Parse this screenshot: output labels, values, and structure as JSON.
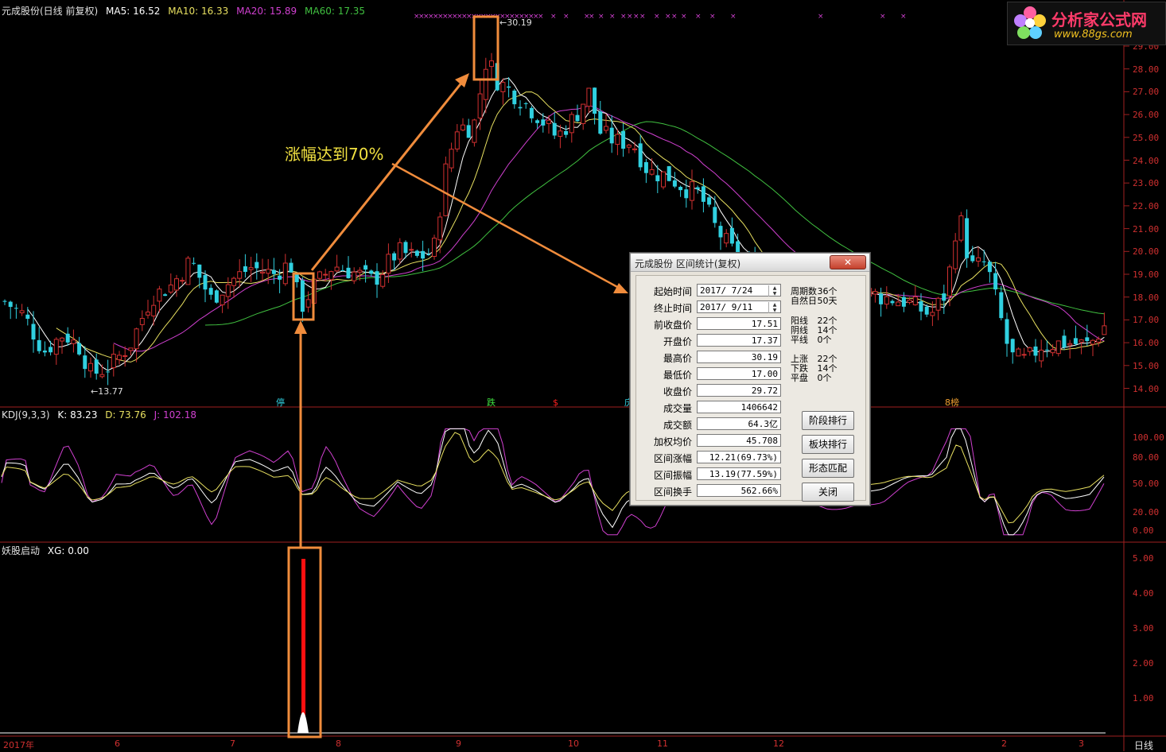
{
  "header": {
    "main": {
      "title": "元成股份(日线 前复权)",
      "ma5": "MA5: 16.52",
      "ma10": "MA10: 16.33",
      "ma20": "MA20: 15.89",
      "ma60": "MA60: 17.35"
    },
    "kdj": {
      "title": "KDJ(9,3,3)",
      "k": "K: 83.23",
      "d": "D: 73.76",
      "j": "J: 102.18"
    },
    "xg": {
      "title": "妖股启动",
      "xg": "XG: 0.00"
    }
  },
  "colors": {
    "ma5": "#ffffff",
    "ma10": "#e8e060",
    "ma20": "#d040d0",
    "ma60": "#40c040",
    "up": "#d03030",
    "down": "#30d0e0",
    "annotation": "#f08c3c",
    "k": "#ffffff",
    "d": "#e8e060",
    "j": "#d040d0",
    "xg_bar": "#ff1010"
  },
  "price_axis": [
    "29.00",
    "28.00",
    "27.00",
    "26.00",
    "25.00",
    "24.00",
    "23.00",
    "22.00",
    "21.00",
    "20.00",
    "19.00",
    "18.00",
    "17.00",
    "16.00",
    "15.00",
    "14.00"
  ],
  "kdj_axis": [
    "100.00",
    "80.00",
    "50.00",
    "20.00",
    "0.00"
  ],
  "xg_axis": [
    "5.00",
    "4.00",
    "3.00",
    "2.00",
    "1.00"
  ],
  "date_axis": [
    "2017年",
    "6",
    "7",
    "8",
    "9",
    "10",
    "11",
    "12",
    "2",
    "3"
  ],
  "period_label": "日线",
  "markers": {
    "high": "30.19",
    "low": "13.77"
  },
  "event_labels": [
    {
      "text": "停",
      "color": "#30d0e0"
    },
    {
      "text": "跌",
      "color": "#40e040"
    },
    {
      "text": "$",
      "color": "#ff2020"
    },
    {
      "text": "庆",
      "color": "#30d0e0"
    },
    {
      "text": "8榜",
      "color": "#f0a030"
    }
  ],
  "annotation": {
    "text": "涨幅达到70%"
  },
  "logo": {
    "name": "分析家公式网",
    "url": "www.88gs.com"
  },
  "dialog": {
    "title": "元成股份 区间统计(复权)",
    "close": "✕",
    "fields": [
      {
        "label": "起始时间",
        "value": "2017/ 7/24"
      },
      {
        "label": "终止时间",
        "value": "2017/ 9/11"
      },
      {
        "label": "前收盘价",
        "value": "17.51"
      },
      {
        "label": "开盘价",
        "value": "17.37"
      },
      {
        "label": "最高价",
        "value": "30.19"
      },
      {
        "label": "最低价",
        "value": "17.00"
      },
      {
        "label": "收盘价",
        "value": "29.72"
      },
      {
        "label": "成交量",
        "value": "1406642"
      },
      {
        "label": "成交额",
        "value": "64.3亿"
      },
      {
        "label": "加权均价",
        "value": "45.708"
      },
      {
        "label": "区间涨幅",
        "value": "12.21(69.73%)"
      },
      {
        "label": "区间振幅",
        "value": "13.19(77.59%)"
      },
      {
        "label": "区间换手",
        "value": "562.66%"
      }
    ],
    "stats": [
      {
        "label": "周期数",
        "value": "36个"
      },
      {
        "label": "自然日",
        "value": "50天"
      },
      {
        "label": "阳线",
        "value": "22个"
      },
      {
        "label": "阴线",
        "value": "14个"
      },
      {
        "label": "平线",
        "value": "0个"
      },
      {
        "label": "上涨",
        "value": "22个"
      },
      {
        "label": "下跌",
        "value": "14个"
      },
      {
        "label": "平盘",
        "value": "0个"
      }
    ],
    "buttons": [
      "阶段排行",
      "板块排行",
      "形态匹配",
      "关闭"
    ]
  }
}
